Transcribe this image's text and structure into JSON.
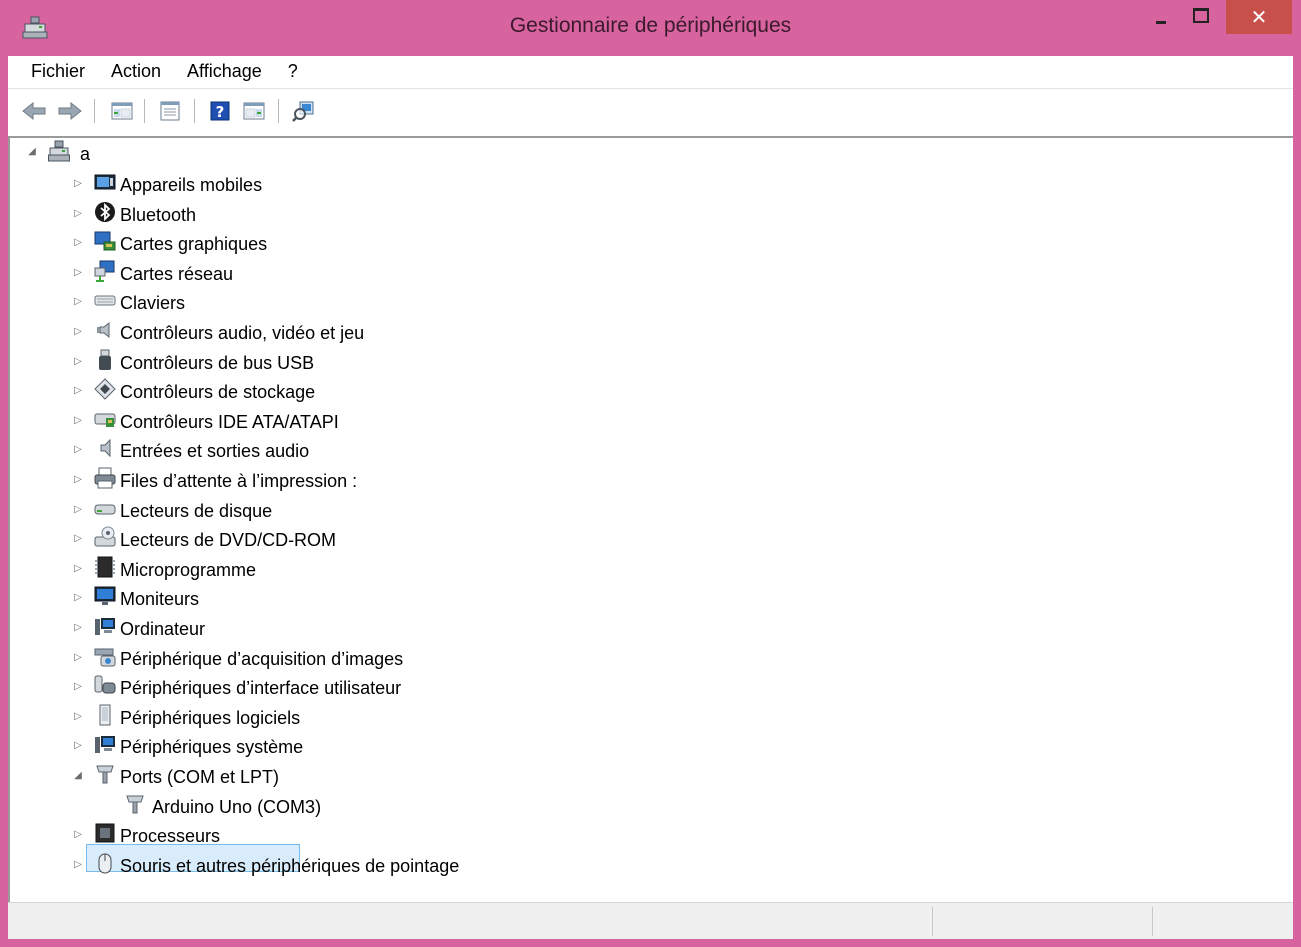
{
  "window": {
    "title": "Gestionnaire de périphériques",
    "close_glyph": "✕"
  },
  "menu": [
    "Fichier",
    "Action",
    "Affichage",
    "?"
  ],
  "toolbar": {
    "buttons": [
      "back-arrow-icon",
      "forward-arrow-icon",
      "show-hide-console-tree-icon",
      "properties-icon",
      "help-icon",
      "show-hide-action-pane-icon",
      "scan-hardware-icon"
    ]
  },
  "tree": {
    "root": {
      "label": "a",
      "icon": "computer-icon"
    },
    "categories": [
      {
        "label": "Appareils mobiles",
        "icon": "mobile-devices-icon"
      },
      {
        "label": "Bluetooth",
        "icon": "bluetooth-icon"
      },
      {
        "label": "Cartes graphiques",
        "icon": "display-adapter-icon"
      },
      {
        "label": "Cartes réseau",
        "icon": "network-adapter-icon"
      },
      {
        "label": "Claviers",
        "icon": "keyboard-icon"
      },
      {
        "label": "Contrôleurs audio, vidéo et jeu",
        "icon": "speaker-icon"
      },
      {
        "label": "Contrôleurs de bus USB",
        "icon": "usb-icon"
      },
      {
        "label": "Contrôleurs de stockage",
        "icon": "storage-controller-icon"
      },
      {
        "label": "Contrôleurs IDE ATA/ATAPI",
        "icon": "ide-controller-icon"
      },
      {
        "label": "Entrées et sorties audio",
        "icon": "audio-io-icon"
      },
      {
        "label": "Files d’attente à l’impression :",
        "icon": "printer-icon"
      },
      {
        "label": "Lecteurs de disque",
        "icon": "disk-drive-icon"
      },
      {
        "label": "Lecteurs de DVD/CD-ROM",
        "icon": "dvd-drive-icon"
      },
      {
        "label": "Microprogramme",
        "icon": "firmware-icon"
      },
      {
        "label": "Moniteurs",
        "icon": "monitor-icon"
      },
      {
        "label": "Ordinateur",
        "icon": "computer-small-icon"
      },
      {
        "label": "Périphérique d’acquisition d’images",
        "icon": "imaging-device-icon"
      },
      {
        "label": "Périphériques d’interface utilisateur",
        "icon": "hid-icon"
      },
      {
        "label": "Périphériques logiciels",
        "icon": "software-device-icon"
      },
      {
        "label": "Périphériques système",
        "icon": "system-device-icon"
      },
      {
        "label": "Ports (COM et LPT)",
        "icon": "port-icon",
        "expanded": true,
        "selected": true,
        "children": [
          {
            "label": "Arduino Uno (COM3)",
            "icon": "port-icon"
          }
        ]
      },
      {
        "label": "Processeurs",
        "icon": "processor-icon"
      },
      {
        "label": "Souris et autres périphériques de pointage",
        "icon": "mouse-icon"
      }
    ]
  },
  "colors": {
    "frame": "#d7639f",
    "close_button": "#c7504b",
    "selection_bg": "#d9ecfb",
    "selection_border": "#77bde8"
  }
}
